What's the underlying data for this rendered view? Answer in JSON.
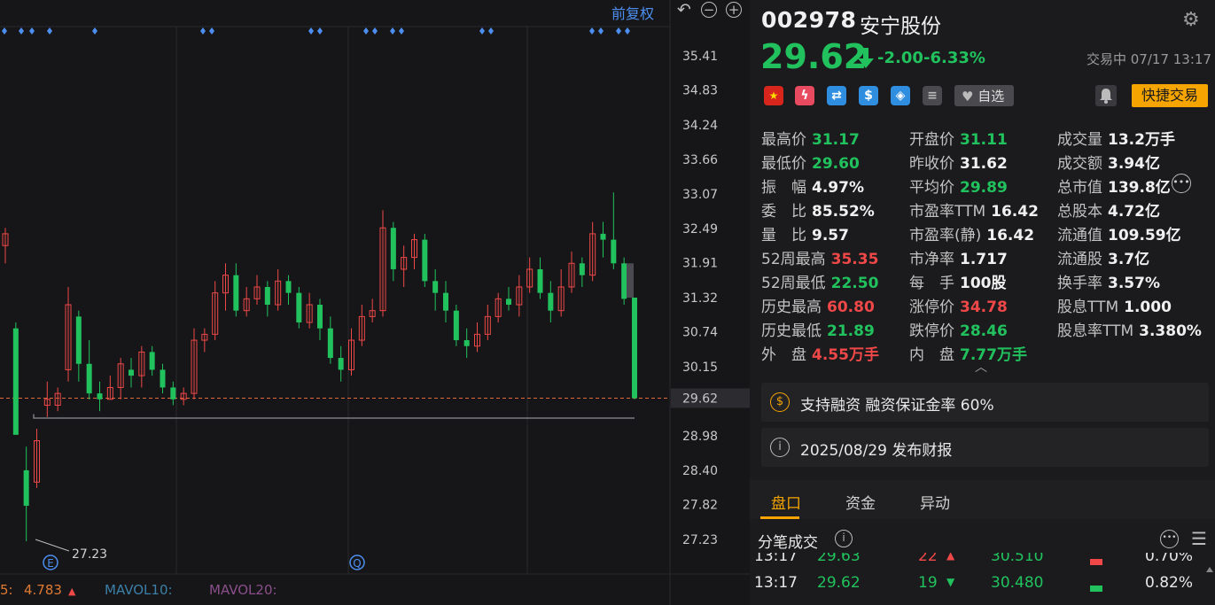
{
  "toolbar": {
    "restore_label": "前复权",
    "zoom_out_symbol": "−",
    "zoom_in_symbol": "+"
  },
  "chart_data": {
    "type": "candlestick",
    "y_ticks": [
      "35.41",
      "34.83",
      "34.24",
      "33.66",
      "33.07",
      "32.49",
      "31.91",
      "31.32",
      "30.74",
      "30.15",
      "29.62",
      "28.98",
      "28.40",
      "27.82",
      "27.23"
    ],
    "ylim": [
      27.23,
      35.41
    ],
    "current_price": 29.62,
    "prev_close": 31.62,
    "low_annotation": "27.23",
    "markers": [
      "E",
      "Q"
    ],
    "candles": [
      [
        32.2,
        32.4,
        32.5,
        31.9
      ],
      [
        30.8,
        29.0,
        30.9,
        29.0
      ],
      [
        28.4,
        27.8,
        28.8,
        27.2
      ],
      [
        28.2,
        28.9,
        29.1,
        28.1
      ],
      [
        29.5,
        29.6,
        29.9,
        29.3
      ],
      [
        29.5,
        29.7,
        29.8,
        29.4
      ],
      [
        30.1,
        31.2,
        31.5,
        29.9
      ],
      [
        31.0,
        30.2,
        31.1,
        29.9
      ],
      [
        30.2,
        29.7,
        30.6,
        29.6
      ],
      [
        29.7,
        29.6,
        29.9,
        29.4
      ],
      [
        29.6,
        29.8,
        30.0,
        29.6
      ],
      [
        29.8,
        30.2,
        30.3,
        29.6
      ],
      [
        30.1,
        30.0,
        30.3,
        29.8
      ],
      [
        30.0,
        30.4,
        30.5,
        29.8
      ],
      [
        30.4,
        30.1,
        30.5,
        30.0
      ],
      [
        30.1,
        29.8,
        30.2,
        29.7
      ],
      [
        29.8,
        29.6,
        29.9,
        29.5
      ],
      [
        29.6,
        29.7,
        29.8,
        29.5
      ],
      [
        29.7,
        30.6,
        30.8,
        29.6
      ],
      [
        30.6,
        30.7,
        30.8,
        30.4
      ],
      [
        30.7,
        31.4,
        31.6,
        30.6
      ],
      [
        31.4,
        31.7,
        31.9,
        31.1
      ],
      [
        31.7,
        31.1,
        31.9,
        31.0
      ],
      [
        31.1,
        31.3,
        31.5,
        31.0
      ],
      [
        31.3,
        31.5,
        31.7,
        31.2
      ],
      [
        31.5,
        31.2,
        31.6,
        31.0
      ],
      [
        31.2,
        31.6,
        31.8,
        31.1
      ],
      [
        31.6,
        31.4,
        31.7,
        31.2
      ],
      [
        31.4,
        30.9,
        31.5,
        30.8
      ],
      [
        30.9,
        31.2,
        31.4,
        30.8
      ],
      [
        31.2,
        30.8,
        31.3,
        30.6
      ],
      [
        30.8,
        30.3,
        31.0,
        30.2
      ],
      [
        30.3,
        30.1,
        30.5,
        29.9
      ],
      [
        30.1,
        30.6,
        30.8,
        30.0
      ],
      [
        30.6,
        31.0,
        31.2,
        30.5
      ],
      [
        31.0,
        31.1,
        31.3,
        30.9
      ],
      [
        31.1,
        32.5,
        32.8,
        31.0
      ],
      [
        32.5,
        31.8,
        32.6,
        31.6
      ],
      [
        31.8,
        32.0,
        32.2,
        31.5
      ],
      [
        32.0,
        32.3,
        32.4,
        31.8
      ],
      [
        32.3,
        31.6,
        32.4,
        31.5
      ],
      [
        31.6,
        31.4,
        31.8,
        31.1
      ],
      [
        31.4,
        31.1,
        31.6,
        30.9
      ],
      [
        31.1,
        30.6,
        31.2,
        30.5
      ],
      [
        30.6,
        30.5,
        30.8,
        30.3
      ],
      [
        30.5,
        30.7,
        30.9,
        30.4
      ],
      [
        30.7,
        31.0,
        31.2,
        30.6
      ],
      [
        31.0,
        31.3,
        31.4,
        30.9
      ],
      [
        31.3,
        31.2,
        31.5,
        31.1
      ],
      [
        31.2,
        31.5,
        31.7,
        31.0
      ],
      [
        31.5,
        31.8,
        32.0,
        31.4
      ],
      [
        31.8,
        31.4,
        32.0,
        31.3
      ],
      [
        31.4,
        31.1,
        31.6,
        30.9
      ],
      [
        31.1,
        31.5,
        31.8,
        31.0
      ],
      [
        31.5,
        31.9,
        32.1,
        31.4
      ],
      [
        31.9,
        31.7,
        32.0,
        31.5
      ],
      [
        31.7,
        32.4,
        32.6,
        31.6
      ],
      [
        32.4,
        32.3,
        32.6,
        32.0
      ],
      [
        32.3,
        31.9,
        33.1,
        31.8
      ],
      [
        31.9,
        31.3,
        32.0,
        31.2
      ],
      [
        31.32,
        29.62,
        31.32,
        29.6
      ]
    ]
  },
  "volume_bar": {
    "ma5_label": "5:",
    "ma5_value": "4.783",
    "ma10_label": "MAVOL10:",
    "ma20_label": "MAVOL20:"
  },
  "quote": {
    "code": "002978",
    "name": "安宁股份",
    "price": "29.62",
    "change": "-2.00",
    "change_pct": "-6.33%",
    "status": "交易中 07/17 13:17"
  },
  "badges": {
    "watch_label": "自选",
    "quick_trade_label": "快捷交易"
  },
  "stats": {
    "col1": [
      {
        "k": "最高价",
        "v": "31.17",
        "c": "g"
      },
      {
        "k": "最低价",
        "v": "29.60",
        "c": "g"
      },
      {
        "k": "振　幅",
        "v": "4.97%",
        "c": "w"
      },
      {
        "k": "委　比",
        "v": "85.52%",
        "c": "w"
      },
      {
        "k": "量　比",
        "v": "9.57",
        "c": "w"
      },
      {
        "k": "52周最高",
        "v": "35.35",
        "c": "r"
      },
      {
        "k": "52周最低",
        "v": "22.50",
        "c": "g"
      },
      {
        "k": "历史最高",
        "v": "60.80",
        "c": "r"
      },
      {
        "k": "历史最低",
        "v": "21.89",
        "c": "g"
      },
      {
        "k": "外　盘",
        "v": "4.55万手",
        "c": "r"
      }
    ],
    "col2": [
      {
        "k": "开盘价",
        "v": "31.11",
        "c": "g"
      },
      {
        "k": "昨收价",
        "v": "31.62",
        "c": "w"
      },
      {
        "k": "平均价",
        "v": "29.89",
        "c": "g"
      },
      {
        "k": "市盈率TTM",
        "v": "16.42",
        "c": "w"
      },
      {
        "k": "市盈率(静)",
        "v": "16.42",
        "c": "w"
      },
      {
        "k": "市净率",
        "v": "1.717",
        "c": "w"
      },
      {
        "k": "每　手",
        "v": "100股",
        "c": "w"
      },
      {
        "k": "涨停价",
        "v": "34.78",
        "c": "r"
      },
      {
        "k": "跌停价",
        "v": "28.46",
        "c": "g"
      },
      {
        "k": "内　盘",
        "v": "7.77万手",
        "c": "g"
      }
    ],
    "col3": [
      {
        "k": "成交量",
        "v": "13.2万手",
        "c": "w"
      },
      {
        "k": "成交额",
        "v": "3.94亿",
        "c": "w"
      },
      {
        "k": "总市值",
        "v": "139.8亿",
        "c": "w"
      },
      {
        "k": "总股本",
        "v": "4.72亿",
        "c": "w"
      },
      {
        "k": "流通值",
        "v": "109.59亿",
        "c": "w"
      },
      {
        "k": "流通股",
        "v": "3.7亿",
        "c": "w"
      },
      {
        "k": "换手率",
        "v": "3.57%",
        "c": "w"
      },
      {
        "k": "股息TTM",
        "v": "1.000",
        "c": "w"
      },
      {
        "k": "股息率TTM",
        "v": "3.380%",
        "c": "w"
      }
    ]
  },
  "notices": {
    "margin_text": "支持融资 融资保证金率 60%",
    "report_text": "2025/08/29  发布财报"
  },
  "tabs": [
    "盘口",
    "资金",
    "异动"
  ],
  "trades": {
    "title": "分笔成交",
    "rows": [
      {
        "time": "13:17",
        "price": "29.63",
        "vol": "22",
        "dir": "up",
        "bid": "30.510",
        "bid_pct": "0.70%"
      },
      {
        "time": "13:17",
        "price": "29.62",
        "vol": "19",
        "dir": "down",
        "bid": "30.480",
        "bid_pct": "0.82%"
      }
    ]
  },
  "colors": {
    "up": "#f04848",
    "down": "#21c25e",
    "accent": "#f6a400",
    "link": "#4d8ff0"
  }
}
